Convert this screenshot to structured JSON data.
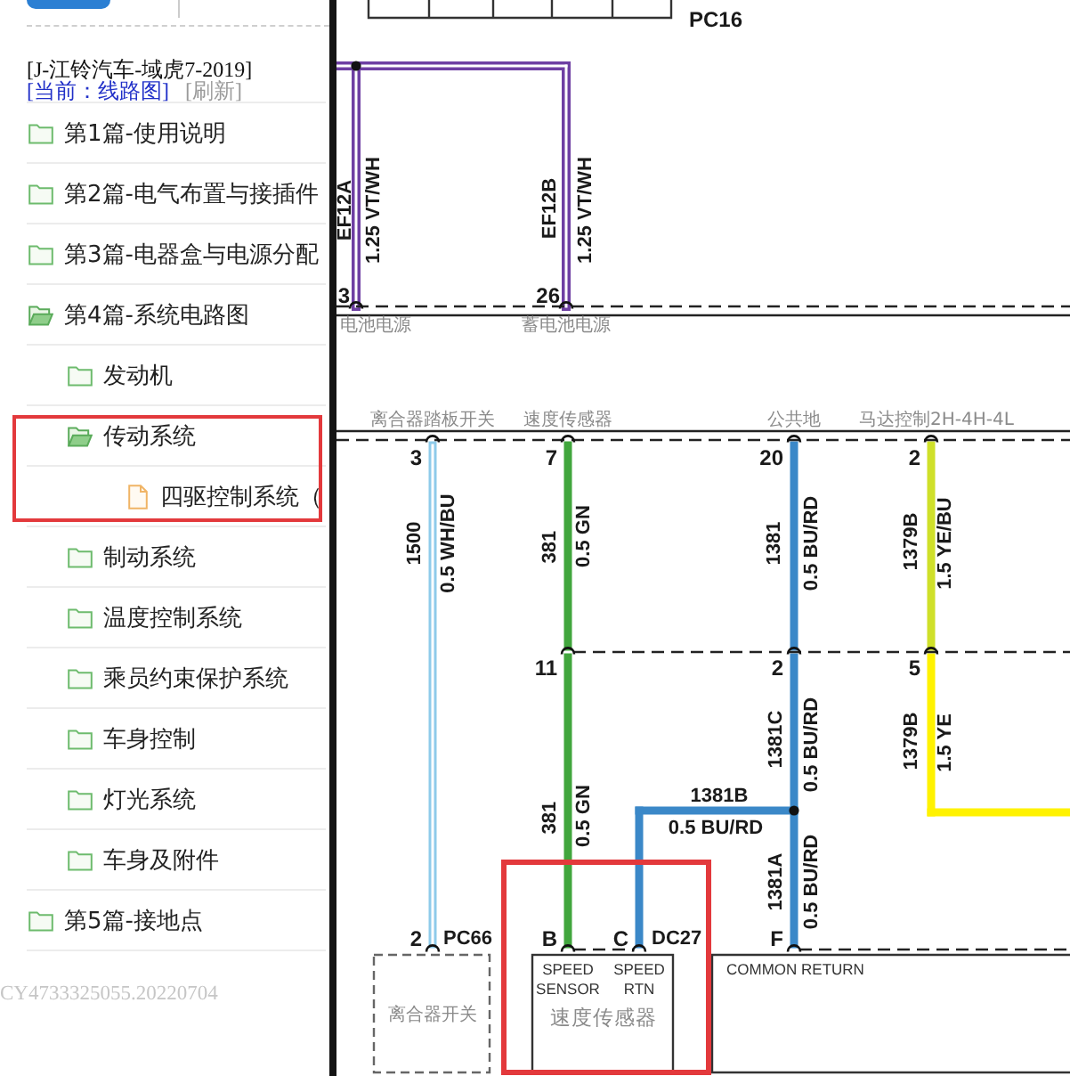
{
  "sidebar": {
    "header": {
      "vehicle": "[J-江铃汽车-域虎7-2019]",
      "current": "[当前：线路图]",
      "refresh": "[刷新]"
    },
    "tree": [
      {
        "label": "第1篇-使用说明",
        "kind": "folder",
        "expanded": false,
        "highlighted": false
      },
      {
        "label": "第2篇-电气布置与接插件",
        "kind": "folder",
        "expanded": false,
        "highlighted": false
      },
      {
        "label": "第3篇-电器盒与电源分配",
        "kind": "folder",
        "expanded": false,
        "highlighted": false
      },
      {
        "label": "第4篇-系统电路图",
        "kind": "folder",
        "expanded": true,
        "highlighted": false,
        "children": [
          {
            "label": "发动机",
            "kind": "folder",
            "expanded": false,
            "highlighted": false
          },
          {
            "label": "传动系统",
            "kind": "folder",
            "expanded": true,
            "highlighted": true,
            "children": [
              {
                "label": "四驱控制系统（",
                "kind": "file",
                "highlighted": false
              }
            ]
          },
          {
            "label": "制动系统",
            "kind": "folder",
            "expanded": false,
            "highlighted": false
          },
          {
            "label": "温度控制系统",
            "kind": "folder",
            "expanded": false,
            "highlighted": false
          },
          {
            "label": "乘员约束保护系统",
            "kind": "folder",
            "expanded": false,
            "highlighted": false
          },
          {
            "label": "车身控制",
            "kind": "folder",
            "expanded": false,
            "highlighted": false
          },
          {
            "label": "灯光系统",
            "kind": "folder",
            "expanded": false,
            "highlighted": false
          },
          {
            "label": "车身及附件",
            "kind": "folder",
            "expanded": false,
            "highlighted": false
          }
        ]
      },
      {
        "label": "第5篇-接地点",
        "kind": "folder",
        "expanded": false,
        "highlighted": false
      }
    ],
    "footer": "CY4733325055.20220704"
  },
  "diagram": {
    "top_connector": {
      "name": "PC16"
    },
    "connectors": [
      {
        "pins": [
          {
            "number": "3",
            "label": "电池电源"
          },
          {
            "number": "26",
            "label": "蓄电池电源"
          }
        ]
      },
      {
        "pins": [
          {
            "number": "3",
            "label": "离合器踏板开关"
          },
          {
            "number": "7",
            "label": "速度传感器"
          },
          {
            "number": "20",
            "label": "公共地"
          },
          {
            "number": "2",
            "label": "马达控制2H-4H-4L"
          }
        ]
      },
      {
        "pins": [
          {
            "number": "11"
          },
          {
            "number": "2"
          },
          {
            "number": "5"
          }
        ]
      }
    ],
    "wires": [
      {
        "circuit": "EF12A",
        "spec": "1.25 VT/WH",
        "kind": "hollow",
        "color": "#6e3fa3"
      },
      {
        "circuit": "EF12B",
        "spec": "1.25 VT/WH",
        "kind": "hollow",
        "color": "#6e3fa3"
      },
      {
        "circuit": "1500",
        "spec": "0.5 WH/BU",
        "kind": "hollow",
        "color": "#8ecbea"
      },
      {
        "circuit": "381",
        "spec": "0.5 GN",
        "kind": "solid",
        "color": "#41a63d"
      },
      {
        "circuit": "381",
        "spec": "0.5 GN",
        "kind": "solid",
        "color": "#41a63d"
      },
      {
        "circuit": "1381",
        "spec": "0.5 BU/RD",
        "kind": "solid",
        "color": "#3b88c8"
      },
      {
        "circuit": "1381C",
        "spec": "0.5 BU/RD",
        "kind": "solid",
        "color": "#3b88c8"
      },
      {
        "circuit": "1381B",
        "spec": "0.5 BU/RD",
        "kind": "solid",
        "color": "#3b88c8"
      },
      {
        "circuit": "1381A",
        "spec": "0.5 BU/RD",
        "kind": "solid",
        "color": "#3b88c8"
      },
      {
        "circuit": "1379B",
        "spec": "1.5 YE/BU",
        "kind": "solid",
        "color": "#cfe02a"
      },
      {
        "circuit": "1379B",
        "spec": "1.5 YE",
        "kind": "solid",
        "color": "#fff200"
      }
    ],
    "components": [
      {
        "kind": "dashed",
        "connector": "PC66",
        "pins": [
          {
            "number": "2"
          }
        ],
        "name": "离合器开关"
      },
      {
        "kind": "solid",
        "connector": "DC27",
        "pins": [
          {
            "number": "B",
            "function": "SPEED SENSOR"
          },
          {
            "number": "C",
            "function": "SPEED RTN"
          }
        ],
        "name": "速度传感器"
      },
      {
        "kind": "solid",
        "pins": [
          {
            "number": "F",
            "function": "COMMON RETURN"
          }
        ]
      }
    ],
    "annotations": [
      {
        "kind": "highlight"
      }
    ]
  }
}
